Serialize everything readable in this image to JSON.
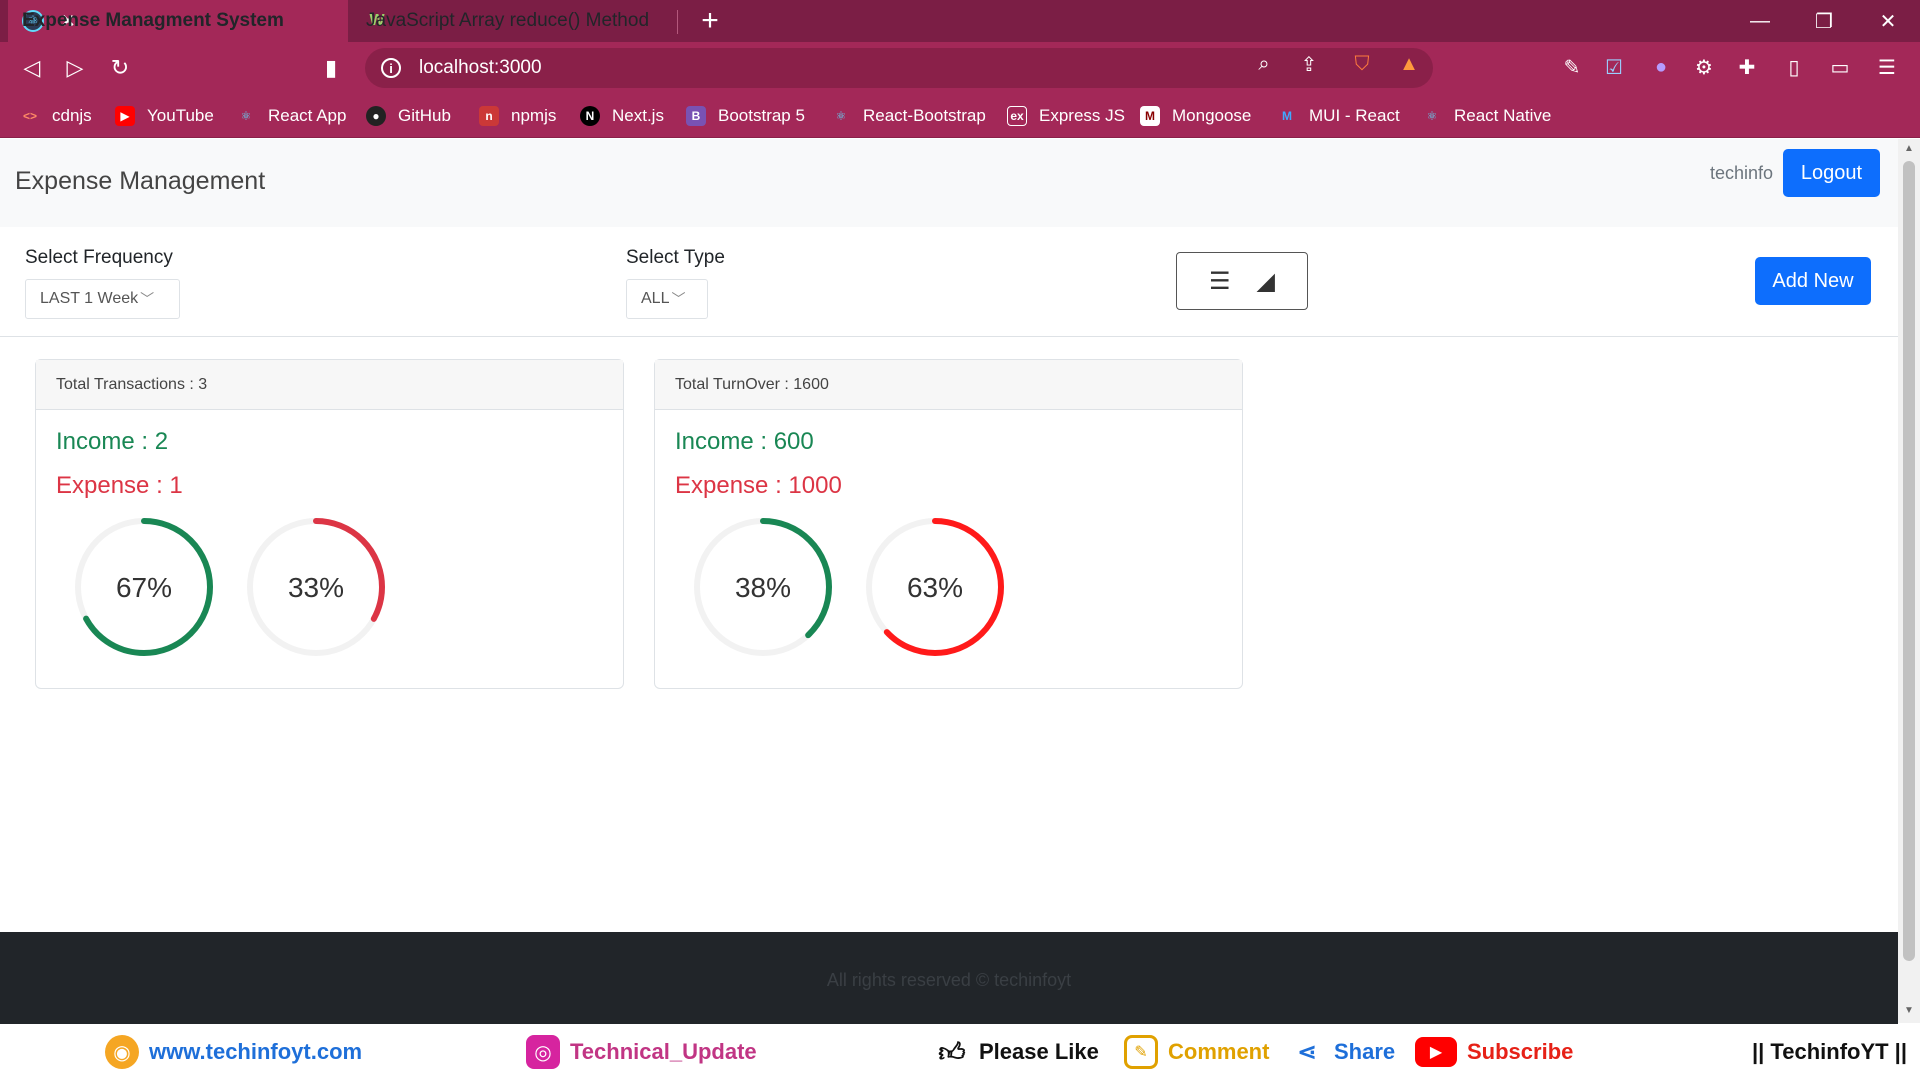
{
  "browser": {
    "tabs": [
      {
        "title": "Expense Managment System",
        "active": true
      },
      {
        "title": "JavaScript Array reduce() Method",
        "active": false
      }
    ],
    "url": "localhost:3000",
    "bookmarks": [
      {
        "label": "cdnjs",
        "icon": "code-icon",
        "color": "#ff8a65"
      },
      {
        "label": "YouTube",
        "icon": "youtube-icon",
        "color": "#ff0000"
      },
      {
        "label": "React App",
        "icon": "react-icon",
        "color": "#61dafb"
      },
      {
        "label": "GitHub",
        "icon": "github-icon",
        "color": "#333333"
      },
      {
        "label": "npmjs",
        "icon": "npm-icon",
        "color": "#cb3837"
      },
      {
        "label": "Next.js",
        "icon": "nextjs-icon",
        "color": "#000000"
      },
      {
        "label": "Bootstrap 5",
        "icon": "bootstrap-icon",
        "color": "#7952b3"
      },
      {
        "label": "React-Bootstrap",
        "icon": "react-icon",
        "color": "#61dafb"
      },
      {
        "label": "Express JS",
        "icon": "express-icon",
        "color": "#444444"
      },
      {
        "label": "Mongoose",
        "icon": "mongoose-icon",
        "color": "#880000"
      },
      {
        "label": "MUI - React",
        "icon": "mui-icon",
        "color": "#007fff"
      },
      {
        "label": "React Native",
        "icon": "react-icon",
        "color": "#61dafb"
      }
    ]
  },
  "app": {
    "brand": "Expense Management",
    "username": "techinfo",
    "logout_label": "Logout",
    "frequency_label": "Select Frequency",
    "frequency_value": "LAST 1 Week",
    "type_label": "Select Type",
    "type_value": "ALL",
    "add_new_label": "Add New",
    "cards": [
      {
        "header": "Total Transactions : 3",
        "income": "Income : 2",
        "expense": "Expense : 1",
        "gauges": [
          {
            "percent": 67,
            "text": "67%",
            "color": "#198754"
          },
          {
            "percent": 33,
            "text": "33%",
            "color": "#dc3545"
          }
        ]
      },
      {
        "header": "Total TurnOver : 1600",
        "income": "Income : 600",
        "expense": "Expense : 1000",
        "gauges": [
          {
            "percent": 38,
            "text": "38%",
            "color": "#198754"
          },
          {
            "percent": 63,
            "text": "63%",
            "color": "#ff1a1a"
          }
        ]
      }
    ],
    "footer": "All rights reserved © techinfoyt"
  },
  "promo": {
    "website": "www.techinfoyt.com",
    "instagram": "Technical_Update",
    "like": "Please Like",
    "comment": "Comment",
    "share": "Share",
    "subscribe": "Subscribe",
    "channel": "|| TechinfoYT ||"
  },
  "colors": {
    "primary": "#0d6efd",
    "income": "#198754",
    "expense": "#dc3545",
    "browser": "#a32858"
  }
}
